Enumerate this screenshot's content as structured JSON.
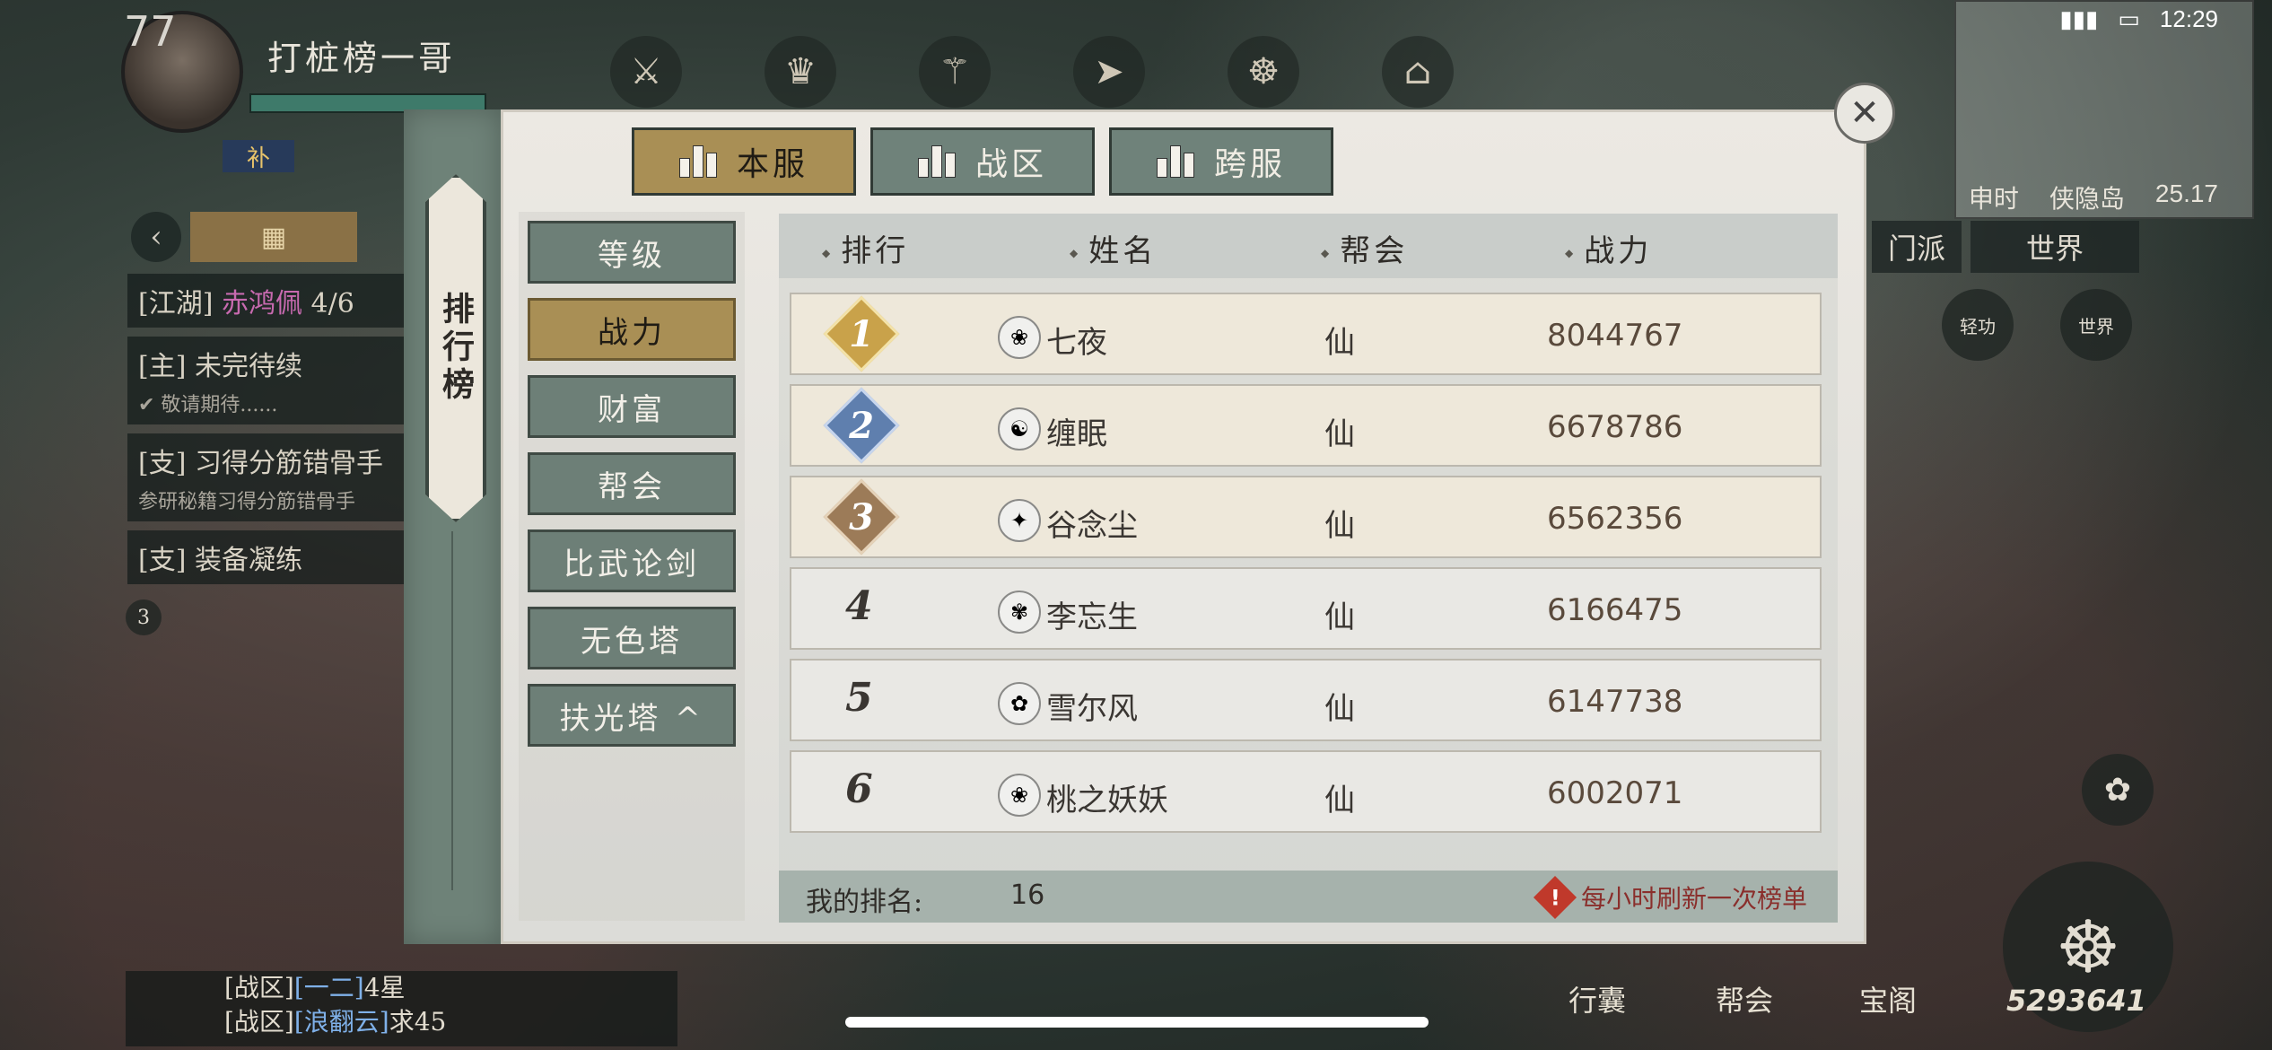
{
  "hud": {
    "level": "77",
    "player_name": "打桩榜一哥",
    "guild_tag": "补",
    "status_time": "12:29",
    "map_time": "申时",
    "map_name": "侠隐岛",
    "map_coord": "25.17",
    "btn_sect": "门派",
    "btn_world": "世界",
    "btn_qinggong": "轻功",
    "btn_world2": "世界",
    "quests": [
      {
        "label": "[江湖]",
        "name": "赤鸿佩",
        "count": "4/6"
      },
      {
        "label": "[主]",
        "name": "未完待续",
        "sub": "✔ 敬请期待......"
      },
      {
        "label": "[支]",
        "name": "习得分筋错骨手",
        "sub": "参研秘籍习得分筋错骨手"
      },
      {
        "label": "[支]",
        "name": "装备凝练"
      }
    ],
    "chat": [
      {
        "ch": "[战区]",
        "who": "[一二]",
        "msg": "4星"
      },
      {
        "ch": "[战区]",
        "who": "[浪翻云]",
        "msg": "求45"
      }
    ],
    "bottom_bag": "行囊",
    "bottom_guild": "帮会",
    "bottom_treasure": "宝阁",
    "power_total": "5293641",
    "notif_count": "3"
  },
  "panel": {
    "side_title": "排行榜",
    "tabs": [
      {
        "label": "本服",
        "active": true
      },
      {
        "label": "战区",
        "active": false
      },
      {
        "label": "跨服",
        "active": false
      }
    ],
    "categories": [
      {
        "label": "等级",
        "active": false
      },
      {
        "label": "战力",
        "active": true
      },
      {
        "label": "财富",
        "active": false
      },
      {
        "label": "帮会",
        "active": false
      },
      {
        "label": "比武论剑",
        "active": false
      },
      {
        "label": "无色塔",
        "active": false
      },
      {
        "label": "扶光塔 ^",
        "active": false
      }
    ],
    "columns": {
      "rank": "排行",
      "name": "姓名",
      "guild": "帮会",
      "power": "战力"
    },
    "rows": [
      {
        "rank": "1",
        "name": "七夜",
        "guild": "仙",
        "power": "8044767",
        "badge_color": "#c9a24a",
        "emblem": "❀"
      },
      {
        "rank": "2",
        "name": "缠眠",
        "guild": "仙",
        "power": "6678786",
        "badge_color": "#5f7fae",
        "emblem": "☯"
      },
      {
        "rank": "3",
        "name": "谷念尘",
        "guild": "仙",
        "power": "6562356",
        "badge_color": "#9c7b58",
        "emblem": "✦"
      },
      {
        "rank": "4",
        "name": "李忘生",
        "guild": "仙",
        "power": "6166475",
        "emblem": "✾"
      },
      {
        "rank": "5",
        "name": "雪尔风",
        "guild": "仙",
        "power": "6147738",
        "emblem": "✿"
      },
      {
        "rank": "6",
        "name": "桃之妖妖",
        "guild": "仙",
        "power": "6002071",
        "emblem": "❀"
      }
    ],
    "my_rank_label": "我的排名:",
    "my_rank_value": "16",
    "refresh_note": "每小时刷新一次榜单"
  }
}
